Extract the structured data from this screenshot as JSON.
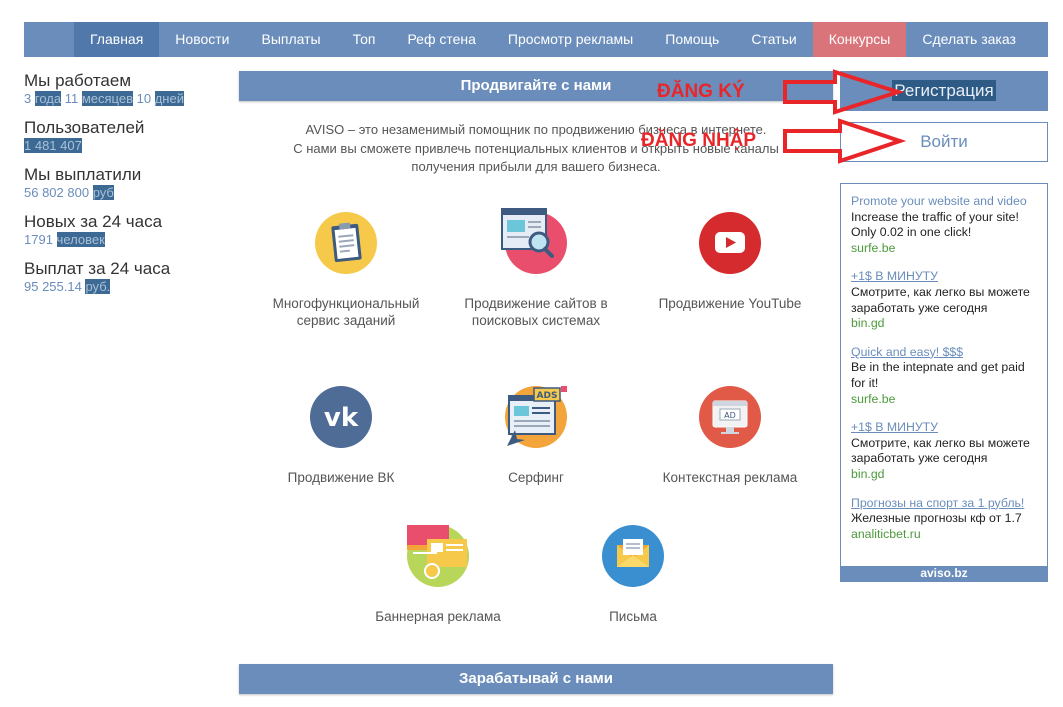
{
  "nav": {
    "items": [
      {
        "label": "Главная"
      },
      {
        "label": "Новости"
      },
      {
        "label": "Выплаты"
      },
      {
        "label": "Топ"
      },
      {
        "label": "Реф стена"
      },
      {
        "label": "Просмотр рекламы"
      },
      {
        "label": "Помощь"
      },
      {
        "label": "Статьи"
      },
      {
        "label": "Конкурсы"
      },
      {
        "label": "Сделать заказ"
      }
    ]
  },
  "stats": {
    "working": {
      "title": "Мы работаем",
      "years": "3",
      "years_unit": "года",
      "months": "11",
      "months_unit": "месяцев",
      "days": "10",
      "days_unit": "дней"
    },
    "users": {
      "title": "Пользователей",
      "value": "1 481 407"
    },
    "paid": {
      "title": "Мы выплатили",
      "value": "56 802 800",
      "unit": "руб"
    },
    "new24": {
      "title": "Новых за 24 часа",
      "value": "1791",
      "unit": "человек"
    },
    "payouts24": {
      "title": "Выплат за 24 часа",
      "value": "95 255.14",
      "unit": "руб."
    }
  },
  "main": {
    "section_top": "Продвигайте с нами",
    "intro_lines": [
      "AVISO – это незаменимый помощник по продвижению бизнеса в интернете.",
      "С нами вы сможете привлечь потенциальных клиентов и открыть новые каналы",
      "получения прибыли для вашего бизнеса."
    ],
    "services": [
      {
        "label": "Многофункциональный сервис заданий",
        "icon": "clipboard-icon"
      },
      {
        "label": "Продвижение сайтов в поисковых системах",
        "icon": "seo-search-icon"
      },
      {
        "label": "Продвижение YouTube",
        "icon": "youtube-icon"
      },
      {
        "label": "Продвижение ВК",
        "icon": "vk-icon"
      },
      {
        "label": "Серфинг",
        "icon": "ads-surfing-icon"
      },
      {
        "label": "Контекстная реклама",
        "icon": "context-ad-icon"
      },
      {
        "label": "Баннерная реклама",
        "icon": "banner-icon"
      },
      {
        "label": "Письма",
        "icon": "envelope-icon"
      }
    ],
    "section_bottom": "Зарабатывай с нами"
  },
  "auth": {
    "register_label": "Регистрация",
    "login_label": "Войти"
  },
  "annotations": {
    "register": "ĐĂNG KÝ",
    "login": "ĐĂNG NHẬP"
  },
  "ads": {
    "items": [
      {
        "title": "Promote your website and video",
        "text": "Increase the traffic of your site! Only 0.02 in one click!",
        "url": "surfe.be",
        "underline": false
      },
      {
        "title": "+1$ В МИНУТУ",
        "text": "Смотрите, как легко вы можете заработать уже сегодня",
        "url": "bin.gd",
        "underline": true
      },
      {
        "title": "Quick and easy! $$$",
        "text": "Be in the intepnate and get paid for it!",
        "url": "surfe.be",
        "underline": true
      },
      {
        "title": "+1$ В МИНУТУ",
        "text": "Смотрите, как легко вы можете заработать уже сегодня",
        "url": "bin.gd",
        "underline": true
      },
      {
        "title": "Прогнозы на спорт за 1 рубль!",
        "text": "Железные прогнозы кф от 1.7",
        "url": "analiticbet.ru",
        "underline": true
      }
    ],
    "footer": "aviso.bz"
  },
  "colors": {
    "nav": "#6a8dbb",
    "nav_active": "#5078ab",
    "contest": "#d9747a",
    "annotation": "#e8262a",
    "ad_url": "#4c9a3a"
  }
}
